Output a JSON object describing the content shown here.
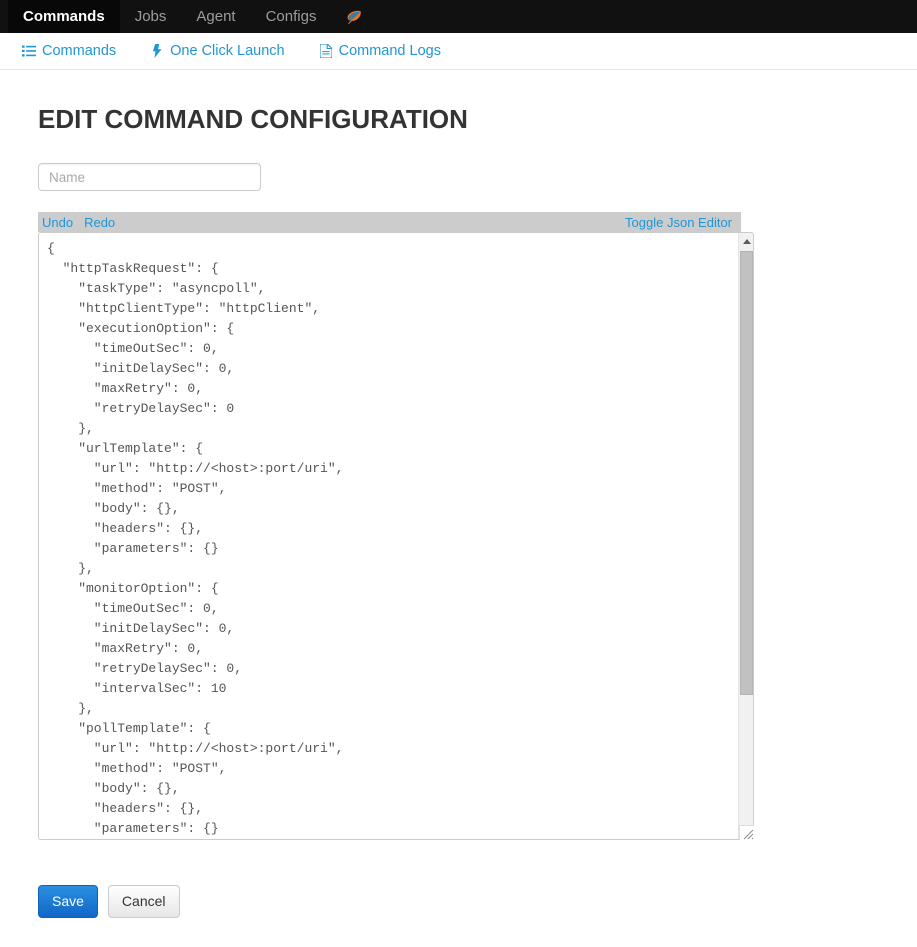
{
  "navbar": {
    "tabs": [
      {
        "label": "Commands",
        "active": true
      },
      {
        "label": "Jobs",
        "active": false
      },
      {
        "label": "Agent",
        "active": false
      },
      {
        "label": "Configs",
        "active": false
      }
    ],
    "brand_icon": "leaf-icon"
  },
  "subnav": {
    "items": [
      {
        "label": "Commands",
        "icon": "list-icon"
      },
      {
        "label": "One Click Launch",
        "icon": "bolt-icon"
      },
      {
        "label": "Command Logs",
        "icon": "file-text-icon"
      }
    ]
  },
  "main": {
    "title": "EDIT COMMAND CONFIGURATION",
    "name_field": {
      "value": "",
      "placeholder": "Name"
    },
    "editor_toolbar": {
      "undo_label": "Undo",
      "redo_label": "Redo",
      "toggle_label": "Toggle Json Editor"
    },
    "editor": {
      "content": "{\n  \"httpTaskRequest\": {\n    \"taskType\": \"asyncpoll\",\n    \"httpClientType\": \"httpClient\",\n    \"executionOption\": {\n      \"timeOutSec\": 0,\n      \"initDelaySec\": 0,\n      \"maxRetry\": 0,\n      \"retryDelaySec\": 0\n    },\n    \"urlTemplate\": {\n      \"url\": \"http://<host>:port/uri\",\n      \"method\": \"POST\",\n      \"body\": {},\n      \"headers\": {},\n      \"parameters\": {}\n    },\n    \"monitorOption\": {\n      \"timeOutSec\": 0,\n      \"initDelaySec\": 0,\n      \"maxRetry\": 0,\n      \"retryDelaySec\": 0,\n      \"intervalSec\": 10\n    },\n    \"pollTemplate\": {\n      \"url\": \"http://<host>:port/uri\",\n      \"method\": \"POST\",\n      \"body\": {},\n      \"headers\": {},\n      \"parameters\": {}\n    }\n  }\n}"
    },
    "buttons": {
      "save_label": "Save",
      "cancel_label": "Cancel"
    }
  },
  "colors": {
    "navbar_bg": "#111111",
    "navbar_active_bg": "#080808",
    "link_blue": "#2196d3",
    "primary_button": "#1267c6",
    "toolbar_gray": "#cccccc",
    "text_dark": "#333333"
  }
}
